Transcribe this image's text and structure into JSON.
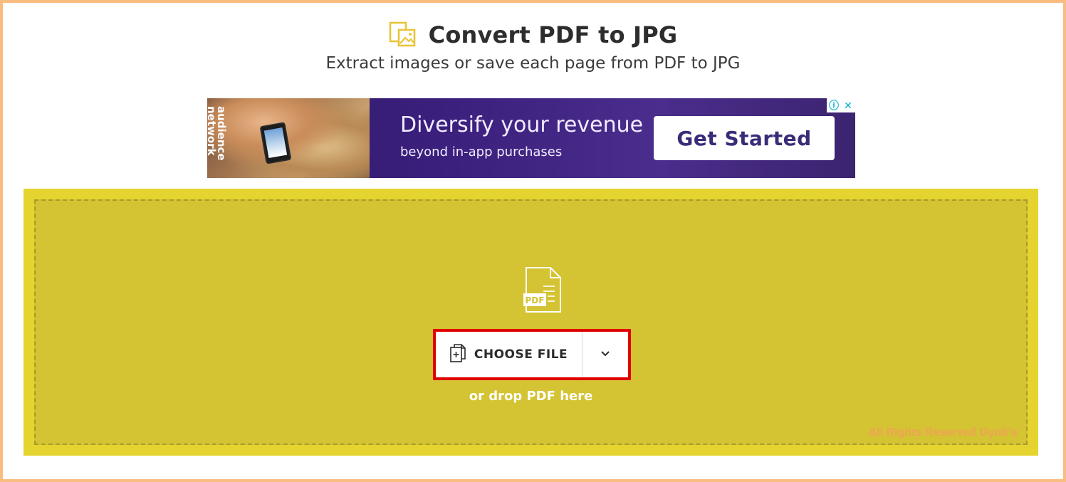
{
  "header": {
    "title": "Convert PDF to JPG",
    "subtitle": "Extract images or save each page from PDF to JPG",
    "icon": "pdf-to-image-icon"
  },
  "ad": {
    "brand": "audience network",
    "headline": "Diversify your revenue",
    "subline": "beyond in-app purchases",
    "cta_label": "Get Started",
    "info_glyph": "ⓘ",
    "close_glyph": "✕"
  },
  "dropzone": {
    "file_icon_label": "PDF",
    "choose_label": "CHOOSE FILE",
    "drop_hint": "or drop PDF here",
    "watermark": "All Rights Reserved Gyub's"
  },
  "colors": {
    "frame_border": "#f9bd80",
    "dropzone_outer": "#e5d430",
    "dropzone_inner": "#d4c332",
    "highlight": "#e00000",
    "accent_icon": "#e8c53a",
    "ad_cta_text": "#3a2b78"
  }
}
